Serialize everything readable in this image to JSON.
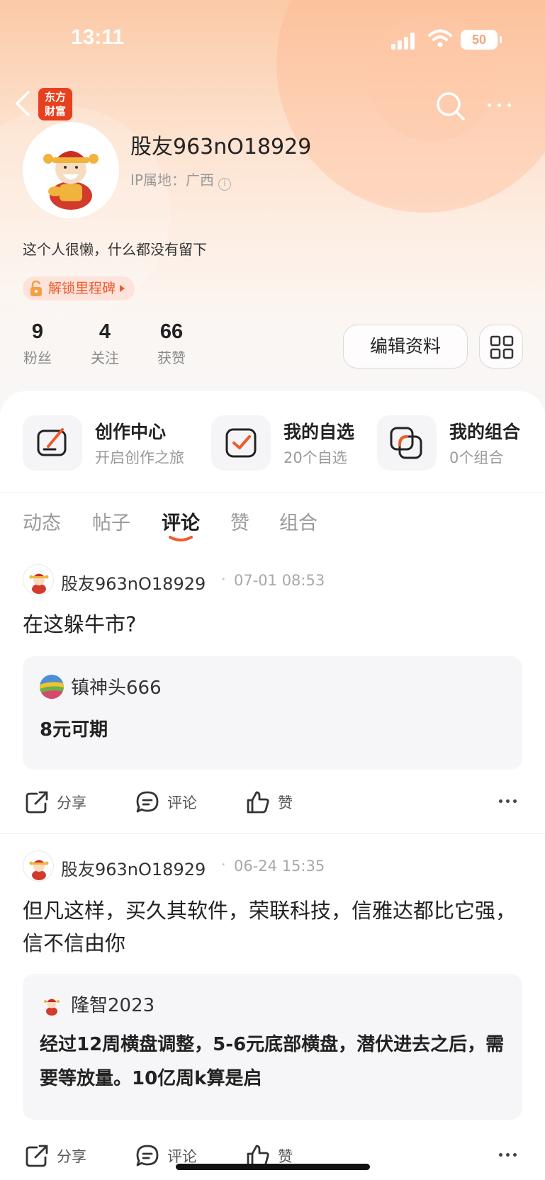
{
  "status_bar": {
    "time": "13:11",
    "battery": "50"
  },
  "header": {
    "logo_line1": "东方",
    "logo_line2": "财富"
  },
  "profile": {
    "username": "股友963nO18929",
    "ip_location": "IP属地：广西",
    "bio": "这个人很懒，什么都没有留下",
    "milestone_label": "解锁里程碑"
  },
  "stats": [
    {
      "value": "9",
      "label": "粉丝"
    },
    {
      "value": "4",
      "label": "关注"
    },
    {
      "value": "66",
      "label": "获赞"
    }
  ],
  "edit_button_label": "编辑资料",
  "quick_links": [
    {
      "title": "创作中心",
      "subtitle": "开启创作之旅",
      "icon": "create-icon"
    },
    {
      "title": "我的自选",
      "subtitle": "20个自选",
      "icon": "watchlist-icon"
    },
    {
      "title": "我的组合",
      "subtitle": "0个组合",
      "icon": "portfolio-icon"
    }
  ],
  "tabs": [
    {
      "label": "动态",
      "active": false
    },
    {
      "label": "帖子",
      "active": false
    },
    {
      "label": "评论",
      "active": true
    },
    {
      "label": "赞",
      "active": false
    },
    {
      "label": "组合",
      "active": false
    }
  ],
  "posts": [
    {
      "author": "股友963nO18929",
      "date": "07-01 08:53",
      "text": "在这躲牛市?",
      "quote": {
        "author": "镇神头666",
        "text": "8元可期"
      }
    },
    {
      "author": "股友963nO18929",
      "date": "06-24 15:35",
      "text": "但凡这样，买久其软件，荣联科技，信雅达都比它强，信不信由你",
      "quote": {
        "author": "隆智2023",
        "text": "经过12周横盘调整，5-6元底部横盘，潜伏进去之后，需要等放量。10亿周k算是启"
      }
    }
  ],
  "actions": {
    "share": "分享",
    "comment": "评论",
    "like": "赞"
  },
  "colors": {
    "accent": "#ef5a2b",
    "logo_red": "#e8401f",
    "header_gradient_top": "#fbc9a6"
  }
}
